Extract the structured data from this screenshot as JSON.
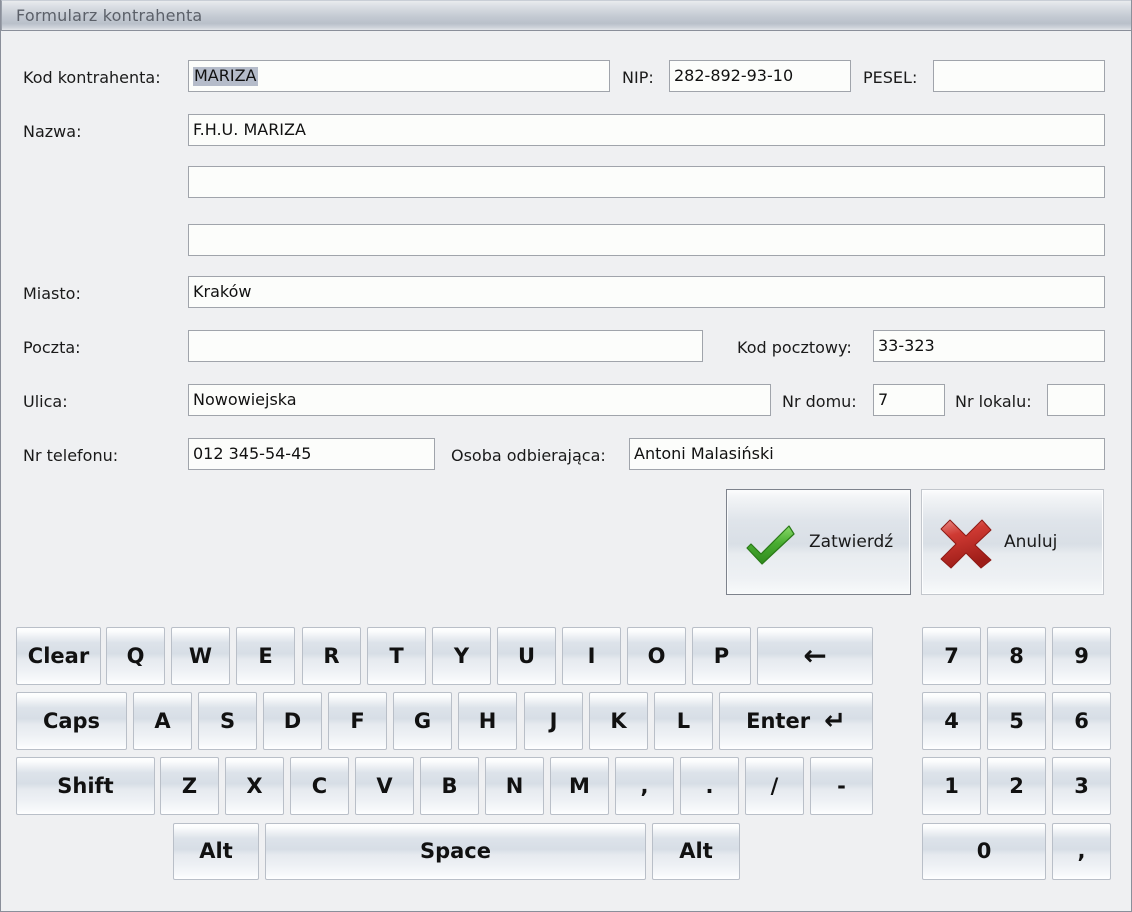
{
  "window": {
    "title": "Formularz kontrahenta"
  },
  "form": {
    "fields": [
      {
        "label": "Kod kontrahenta:",
        "value": "MARIZA",
        "selected": true,
        "name": "kod-kontrahenta"
      },
      {
        "label": "NIP:",
        "value": "282-892-93-10",
        "selected": false,
        "name": "nip"
      },
      {
        "label": "PESEL:",
        "value": "",
        "selected": false,
        "name": "pesel"
      },
      {
        "label": "Nazwa:",
        "value": "F.H.U. MARIZA",
        "selected": false,
        "name": "nazwa"
      },
      {
        "label": "",
        "value": "",
        "selected": false,
        "name": "nazwa-line2"
      },
      {
        "label": "",
        "value": "",
        "selected": false,
        "name": "nazwa-line3"
      },
      {
        "label": "Miasto:",
        "value": "Kraków",
        "selected": false,
        "name": "miasto"
      },
      {
        "label": "Poczta:",
        "value": "",
        "selected": false,
        "name": "poczta"
      },
      {
        "label": "Kod pocztowy:",
        "value": "33-323",
        "selected": false,
        "name": "kod-pocztowy"
      },
      {
        "label": "Ulica:",
        "value": "Nowowiejska",
        "selected": false,
        "name": "ulica"
      },
      {
        "label": "Nr domu:",
        "value": "7",
        "selected": false,
        "name": "nr-domu"
      },
      {
        "label": "Nr lokalu:",
        "value": "",
        "selected": false,
        "name": "nr-lokalu"
      },
      {
        "label": "Nr telefonu:",
        "value": "012 345-54-45",
        "selected": false,
        "name": "nr-telefonu"
      },
      {
        "label": "Osoba odbierająca:",
        "value": "Antoni Malasiński",
        "selected": false,
        "name": "osoba-odbierajaca"
      }
    ]
  },
  "buttons": {
    "confirm": {
      "label": "Zatwierdź",
      "icon": "green-check-icon",
      "focused": true
    },
    "cancel": {
      "label": "Anuluj",
      "icon": "red-cross-icon",
      "focused": false
    }
  },
  "keyboard": {
    "row1": [
      "Clear",
      "Q",
      "W",
      "E",
      "R",
      "T",
      "Y",
      "U",
      "I",
      "O",
      "P",
      "←"
    ],
    "row2": [
      "Caps",
      "A",
      "S",
      "D",
      "F",
      "G",
      "H",
      "J",
      "K",
      "L",
      "Enter"
    ],
    "row3": [
      "Shift",
      "Z",
      "X",
      "C",
      "V",
      "B",
      "N",
      "M",
      ",",
      ".",
      "/",
      "-"
    ],
    "row4": [
      "Alt",
      "Space",
      "Alt"
    ],
    "enter_label": "Enter",
    "enter_glyph": "↵",
    "backspace_glyph": "←"
  },
  "numpad": {
    "row1": [
      "7",
      "8",
      "9"
    ],
    "row2": [
      "4",
      "5",
      "6"
    ],
    "row3": [
      "1",
      "2",
      "3"
    ],
    "row4": [
      "0",
      ","
    ]
  },
  "colors": {
    "window_bg": "#eff0f2",
    "field_bg": "#fcfdfb",
    "field_border": "#a0a4ab",
    "selection": "#b5bcca",
    "title_text": "#5b6069",
    "check_green": "#3ea63a",
    "cross_red": "#cc2222"
  }
}
